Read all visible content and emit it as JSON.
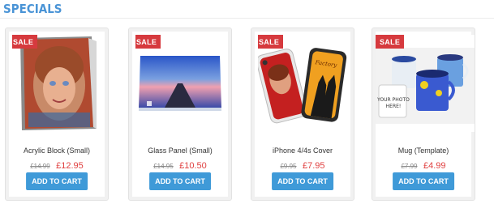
{
  "section": {
    "title": "SPECIALS"
  },
  "products": [
    {
      "name": "Acrylic Block (Small)",
      "old_price": "£14.99",
      "new_price": "£12.95",
      "badge": "SALE",
      "button": "ADD TO CART"
    },
    {
      "name": "Glass Panel (Small)",
      "old_price": "£14.95",
      "new_price": "£10.50",
      "badge": "SALE",
      "button": "ADD TO CART"
    },
    {
      "name": "iPhone 4/4s Cover",
      "old_price": "£9.95",
      "new_price": "£7.95",
      "badge": "SALE",
      "button": "ADD TO CART"
    },
    {
      "name": "Mug (Template)",
      "old_price": "£7.99",
      "new_price": "£4.99",
      "badge": "SALE",
      "button": "ADD TO CART"
    }
  ],
  "mug_image": {
    "text_line1": "YOUR PHOTO",
    "text_line2": "HERE!"
  },
  "phone_image": {
    "script_text": "Factory"
  },
  "colors": {
    "accent": "#3f9ad8",
    "sale": "#d63a3e",
    "price": "#e04040",
    "title": "#4a94d6"
  }
}
